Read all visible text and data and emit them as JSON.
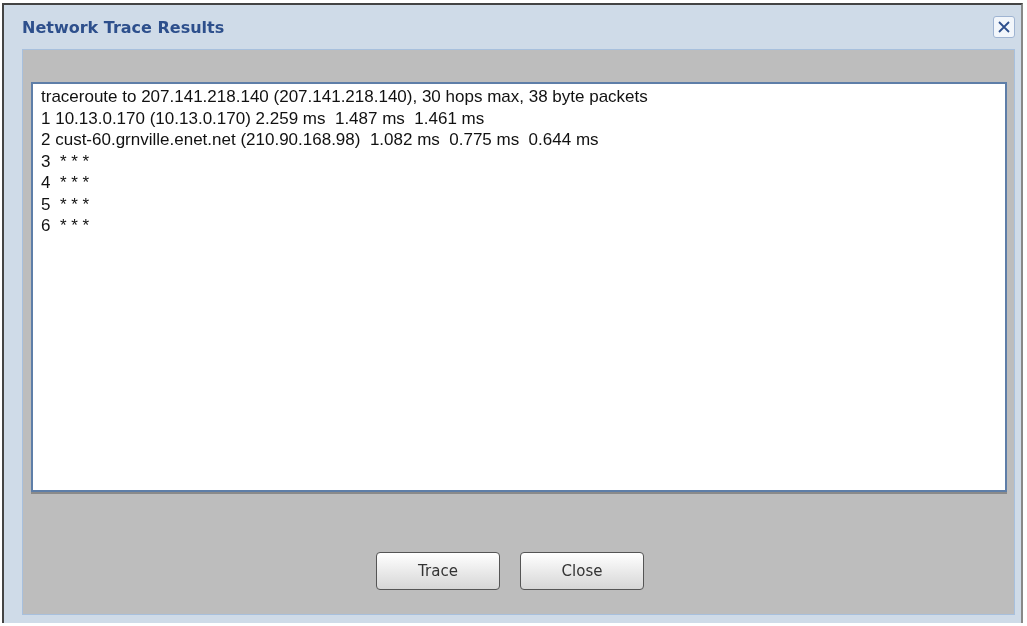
{
  "window": {
    "title": "Network Trace Results"
  },
  "output": {
    "lines": [
      "traceroute to 207.141.218.140 (207.141.218.140), 30 hops max, 38 byte packets",
      "1 10.13.0.170 (10.13.0.170) 2.259 ms  1.487 ms  1.461 ms",
      "2 cust-60.grnville.enet.net (210.90.168.98)  1.082 ms  0.775 ms  0.644 ms",
      "3  * * *",
      "4  * * *",
      "5  * * *",
      "6  * * *"
    ]
  },
  "buttons": [
    "Trace",
    "Close"
  ]
}
